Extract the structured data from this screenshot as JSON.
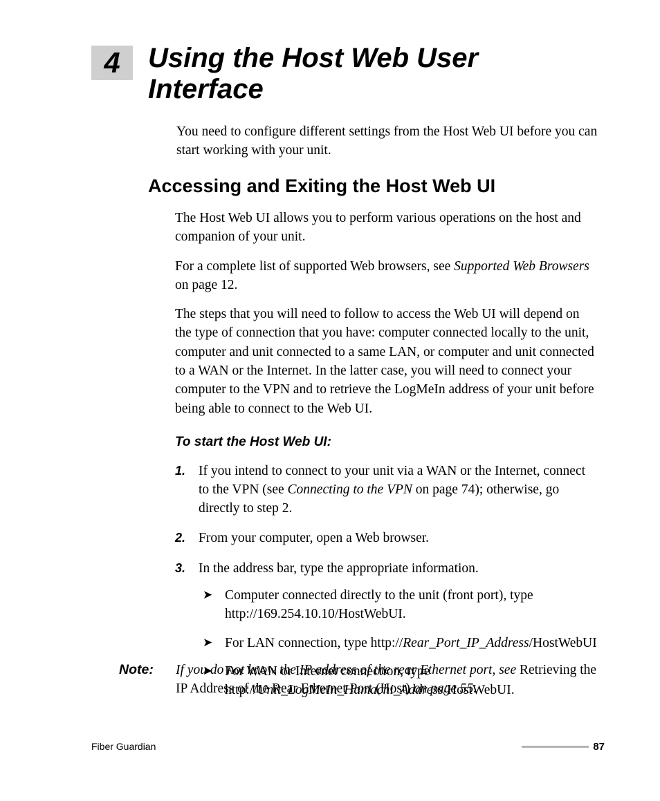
{
  "chapter": {
    "number": "4",
    "title": "Using the Host Web User Interface"
  },
  "intro": "You need to configure different settings from the Host Web UI before you can start working with your unit.",
  "section_heading": "Accessing and Exiting the Host Web UI",
  "p1": "The Host Web UI allows you to perform various operations on the host and companion of your unit.",
  "p2a": "For a complete list of supported Web browsers, see ",
  "p2_ref": "Supported Web Browsers",
  "p2b": " on page 12.",
  "p3": "The steps that you will need to follow to access the Web UI will depend on the type of connection that you have: computer connected locally to the unit, computer and unit connected to a same LAN, or computer and unit connected to a WAN or the Internet. In the latter case, you will need to connect your computer to the VPN and to retrieve the LogMeIn address of your unit before being able to connect to the Web UI.",
  "procedure_title": "To start the Host Web UI:",
  "steps": {
    "s1a": "If you intend to connect to your unit via a WAN or the Internet, connect to the VPN (see ",
    "s1_ref": "Connecting to the VPN",
    "s1b": " on page 74); otherwise, go directly to step 2.",
    "s2": "From your computer, open a Web browser.",
    "s3": "In the address bar, type the appropriate information.",
    "b1": "Computer connected directly to the unit (front port), type http://169.254.10.10/HostWebUI.",
    "b2a": "For LAN connection, type http://",
    "b2_ref": "Rear_Port_IP_Address",
    "b2b": "/HostWebUI",
    "b3a": "For WAN or Internet connection, type http://",
    "b3_ref": "Unit_LogMeIn_Hamachi_Address",
    "b3b": "/HostWebUI."
  },
  "note": {
    "label": "Note:",
    "a": "If you do not know the IP address of the rear Ethernet port, see ",
    "ref": "Retrieving the IP Address of the Rear Ethernet Port (Host)",
    "b": " on page 55."
  },
  "footer": {
    "product": "Fiber Guardian",
    "page": "87"
  }
}
